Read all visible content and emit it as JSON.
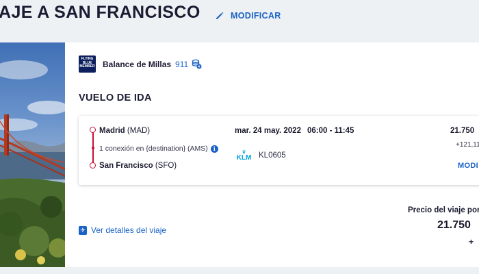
{
  "header": {
    "title": "AJE A SAN FRANCISCO",
    "modify_label": "MODIFICAR"
  },
  "miles": {
    "logo_lines": [
      "FLYING",
      "BLUE",
      "MEMBER"
    ],
    "label": "Balance de Millas",
    "value": "911"
  },
  "outbound": {
    "section_title": "VUELO DE IDA",
    "origin_city": "Madrid",
    "origin_code": "(MAD)",
    "connection_text": "1 conexión en {destination} (AMS)",
    "destination_city": "San Francisco",
    "destination_code": "(SFO)",
    "date": "mar. 24 may. 2022",
    "time": "06:00 - 11:45",
    "airline": "KLM",
    "flight_number": "KL0605",
    "price": "21.750",
    "taxes": "+121,11",
    "modify_label": "MODI"
  },
  "summary": {
    "details_link": "Ver detalles del viaje",
    "price_label": "Precio del viaje por",
    "price": "21.750",
    "price_suffix": "+ "
  },
  "colors": {
    "accent": "#1a62c5",
    "route": "#c8102e",
    "brand_navy": "#0d1f5c",
    "klm": "#00a1de"
  }
}
